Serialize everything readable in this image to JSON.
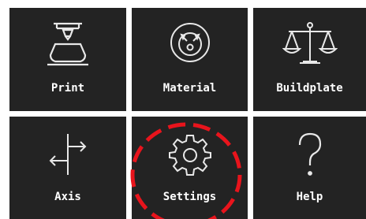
{
  "menu": {
    "tiles": [
      {
        "label": "Print",
        "icon": "print-head-icon"
      },
      {
        "label": "Material",
        "icon": "material-spool-icon"
      },
      {
        "label": "Buildplate",
        "icon": "balance-scale-icon"
      },
      {
        "label": "Axis",
        "icon": "axis-arrows-icon"
      },
      {
        "label": "Settings",
        "icon": "gear-icon"
      },
      {
        "label": "Help",
        "icon": "question-mark-icon"
      }
    ]
  },
  "highlight": {
    "target": "Settings",
    "color": "#e8141c",
    "style": "dashed-circle"
  },
  "colors": {
    "tile_background": "#232323",
    "icon_stroke": "#e8e8e8",
    "label_text": "#ffffff",
    "page_background": "#ffffff"
  }
}
